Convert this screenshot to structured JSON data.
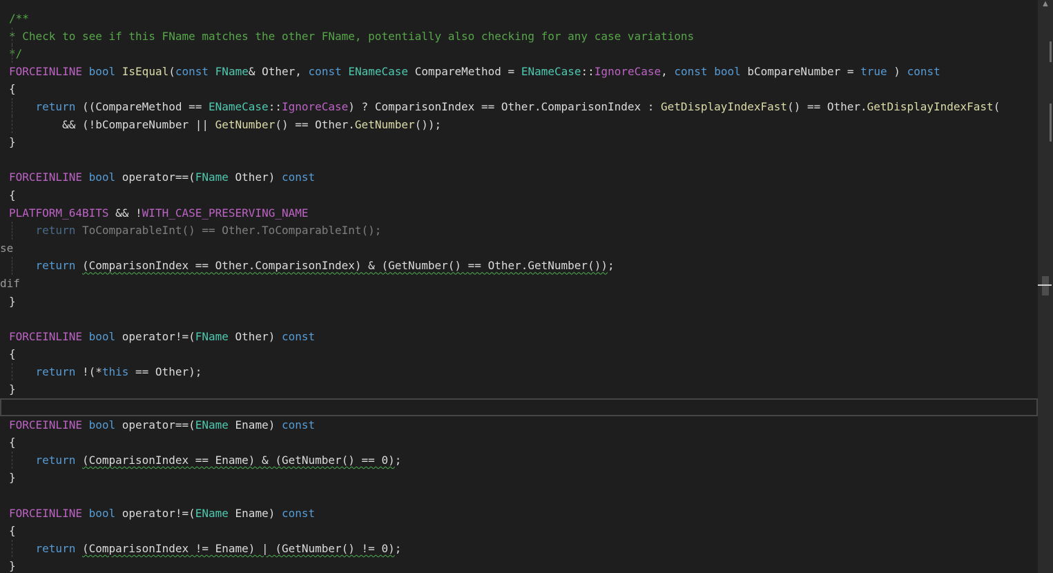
{
  "editor": {
    "lines": [
      [
        {
          "t": "/**",
          "c": "cmt"
        }
      ],
      [
        {
          "t": "* Check to see if this FName matches the other FName, potentially also checking for any case variations",
          "c": "cmt"
        }
      ],
      [
        {
          "t": "*/",
          "c": "cmt"
        }
      ],
      [
        {
          "t": "FORCEINLINE",
          "c": "mc"
        },
        {
          "t": " "
        },
        {
          "t": "bool",
          "c": "kw"
        },
        {
          "t": " "
        },
        {
          "t": "IsEqual",
          "c": "fn"
        },
        {
          "t": "("
        },
        {
          "t": "const",
          "c": "kw"
        },
        {
          "t": " "
        },
        {
          "t": "FName",
          "c": "ty"
        },
        {
          "t": "& Other, "
        },
        {
          "t": "const",
          "c": "kw"
        },
        {
          "t": " "
        },
        {
          "t": "ENameCase",
          "c": "ty"
        },
        {
          "t": " CompareMethod = "
        },
        {
          "t": "ENameCase",
          "c": "ty"
        },
        {
          "t": "::"
        },
        {
          "t": "IgnoreCase",
          "c": "mc"
        },
        {
          "t": ", "
        },
        {
          "t": "const",
          "c": "kw"
        },
        {
          "t": " "
        },
        {
          "t": "bool",
          "c": "kw"
        },
        {
          "t": " bCompareNumber = "
        },
        {
          "t": "true",
          "c": "kw"
        },
        {
          "t": " ) "
        },
        {
          "t": "const",
          "c": "kw"
        }
      ],
      [
        {
          "t": "{"
        }
      ],
      [
        {
          "t": "    "
        },
        {
          "t": "return",
          "c": "kw"
        },
        {
          "t": " ((CompareMethod == "
        },
        {
          "t": "ENameCase",
          "c": "ty"
        },
        {
          "t": "::"
        },
        {
          "t": "IgnoreCase",
          "c": "mc"
        },
        {
          "t": ") ? ComparisonIndex == Other.ComparisonIndex : "
        },
        {
          "t": "GetDisplayIndexFast",
          "c": "fn"
        },
        {
          "t": "() == Other."
        },
        {
          "t": "GetDisplayIndexFast",
          "c": "fn"
        },
        {
          "t": "("
        }
      ],
      [
        {
          "t": "        && (!bCompareNumber || "
        },
        {
          "t": "GetNumber",
          "c": "fn"
        },
        {
          "t": "() == Other."
        },
        {
          "t": "GetNumber",
          "c": "fn"
        },
        {
          "t": "());"
        }
      ],
      [
        {
          "t": "}"
        }
      ],
      [],
      [
        {
          "t": "FORCEINLINE",
          "c": "mc"
        },
        {
          "t": " "
        },
        {
          "t": "bool",
          "c": "kw"
        },
        {
          "t": " operator==("
        },
        {
          "t": "FName",
          "c": "ty"
        },
        {
          "t": " Other) "
        },
        {
          "t": "const",
          "c": "kw"
        }
      ],
      [
        {
          "t": "{"
        }
      ],
      [
        {
          "t": "PLATFORM_64BITS",
          "c": "mc"
        },
        {
          "t": " && !"
        },
        {
          "t": "WITH_CASE_PRESERVING_NAME",
          "c": "mc"
        }
      ],
      [
        {
          "t": "    "
        },
        {
          "t": "return",
          "c": "dimk"
        },
        {
          "t": " ToComparableInt() == Other.ToComparableInt();",
          "c": "dim"
        }
      ],
      [
        {
          "t": "se",
          "c": "pp"
        }
      ],
      [
        {
          "t": "    "
        },
        {
          "t": "return",
          "c": "kw"
        },
        {
          "t": " "
        },
        {
          "t": "(ComparisonIndex == Other.ComparisonIndex) & (GetNumber() == Other.GetNumber())",
          "c": "sq"
        },
        {
          "t": ";"
        }
      ],
      [
        {
          "t": "dif",
          "c": "pp"
        }
      ],
      [
        {
          "t": "}"
        }
      ],
      [],
      [
        {
          "t": "FORCEINLINE",
          "c": "mc"
        },
        {
          "t": " "
        },
        {
          "t": "bool",
          "c": "kw"
        },
        {
          "t": " operator!=("
        },
        {
          "t": "FName",
          "c": "ty"
        },
        {
          "t": " Other) "
        },
        {
          "t": "const",
          "c": "kw"
        }
      ],
      [
        {
          "t": "{"
        }
      ],
      [
        {
          "t": "    "
        },
        {
          "t": "return",
          "c": "kw"
        },
        {
          "t": " !(*"
        },
        {
          "t": "this",
          "c": "kw"
        },
        {
          "t": " == Other);"
        }
      ],
      [
        {
          "t": "}"
        }
      ],
      [],
      [
        {
          "t": "FORCEINLINE",
          "c": "mc"
        },
        {
          "t": " "
        },
        {
          "t": "bool",
          "c": "kw"
        },
        {
          "t": " operator==("
        },
        {
          "t": "EName",
          "c": "ty"
        },
        {
          "t": " Ename) "
        },
        {
          "t": "const",
          "c": "kw"
        }
      ],
      [
        {
          "t": "{"
        }
      ],
      [
        {
          "t": "    "
        },
        {
          "t": "return",
          "c": "kw"
        },
        {
          "t": " "
        },
        {
          "t": "(ComparisonIndex == Ename) & (GetNumber() == 0)",
          "c": "sq"
        },
        {
          "t": ";"
        }
      ],
      [
        {
          "t": "}"
        }
      ],
      [],
      [
        {
          "t": "FORCEINLINE",
          "c": "mc"
        },
        {
          "t": " "
        },
        {
          "t": "bool",
          "c": "kw"
        },
        {
          "t": " operator!=("
        },
        {
          "t": "EName",
          "c": "ty"
        },
        {
          "t": " Ename) "
        },
        {
          "t": "const",
          "c": "kw"
        }
      ],
      [
        {
          "t": "{"
        }
      ],
      [
        {
          "t": "    "
        },
        {
          "t": "return",
          "c": "kw"
        },
        {
          "t": " "
        },
        {
          "t": "(ComparisonIndex != Ename) | (GetNumber() != 0)",
          "c": "sq"
        },
        {
          "t": ";"
        }
      ],
      [
        {
          "t": "}"
        }
      ]
    ],
    "current_line_index": 22
  },
  "colors": {
    "background": "#1e1e1e",
    "comment": "#57a64a",
    "keyword": "#569cd6",
    "type": "#4ec9b0",
    "function": "#dcdcaa",
    "macro": "#bd63c5",
    "squiggle": "#4caf50"
  },
  "scrollbar": {
    "up_icon": "▲"
  }
}
